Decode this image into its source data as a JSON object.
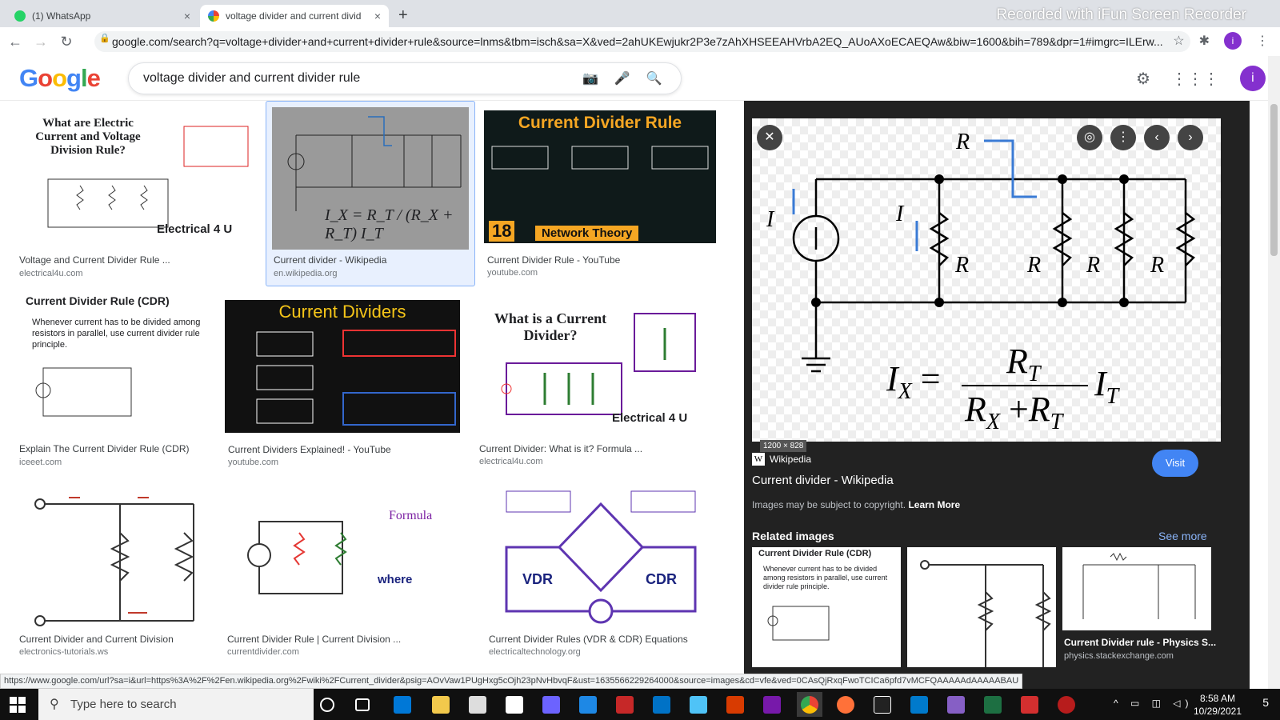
{
  "browser": {
    "tabs": [
      {
        "label": "(1) WhatsApp",
        "close": "×"
      },
      {
        "label": "voltage divider and current divid",
        "close": "×"
      }
    ],
    "new_tab": "+",
    "recorder_watermark": "Recorded with iFun Screen Recorder",
    "url": "google.com/search?q=voltage+divider+and+current+divider+rule&source=lnms&tbm=isch&sa=X&ved=2ahUKEwjukr2P3e7zAhXHSEEAHVrbA2EQ_AUoAXoECAEQAw&biw=1600&bih=789&dpr=1#imgrc=ILErw...",
    "profile_initial": "i"
  },
  "google": {
    "logo": "Google",
    "query": "voltage divider and current divider rule",
    "profile_initial": "i"
  },
  "results": [
    {
      "title": "Voltage and Current Divider Rule ...",
      "source": "electrical4u.com",
      "thumb_heading": "What are Electric Current and Voltage Division Rule?",
      "thumb_brand": "Electrical 4 U"
    },
    {
      "title": "Current divider - Wikipedia",
      "source": "en.wikipedia.org",
      "thumb_formula": "I_X = R_T / (R_X + R_T) I_T"
    },
    {
      "title": "Current Divider Rule - YouTube",
      "source": "youtube.com",
      "thumb_heading": "Current Divider Rule",
      "thumb_badge": "18",
      "thumb_footer": "Network Theory"
    },
    {
      "title": "Explain The Current Divider Rule (CDR)",
      "source": "iceeet.com",
      "thumb_heading": "Current Divider Rule (CDR)",
      "thumb_body": "Whenever current has to be divided among resistors in parallel, use current divider rule principle."
    },
    {
      "title": "Current Dividers Explained! - YouTube",
      "source": "youtube.com",
      "thumb_heading": "Current Dividers"
    },
    {
      "title": "Current Divider: What is it? Formula ...",
      "source": "electrical4u.com",
      "thumb_heading": "What is a Current Divider?",
      "thumb_brand": "Electrical 4 U"
    },
    {
      "title": "Current Divider and Current Division",
      "source": "electronics-tutorials.ws"
    },
    {
      "title": "Current Divider Rule | Current Division ...",
      "source": "currentdivider.com",
      "thumb_formula_label": "Formula",
      "thumb_where": "where"
    },
    {
      "title": "Current Divider Rules (VDR & CDR) Equations",
      "source": "electricaltechnology.org",
      "thumb_left": "VDR",
      "thumb_right": "CDR"
    }
  ],
  "panel": {
    "image_size": "1200 × 828",
    "source_name": "Wikipedia",
    "title": "Current divider - Wikipedia",
    "visit": "Visit",
    "copyright": "Images may be subject to copyright.",
    "learn_more": "Learn More",
    "related_heading": "Related images",
    "see_more": "See more",
    "related": [
      {
        "heading": "Current Divider Rule (CDR)",
        "body": "Whenever current has to be divided among resistors in parallel, use current divider rule principle."
      },
      {
        "heading": ""
      },
      {
        "caption": "Current Divider rule - Physics S...",
        "source": "physics.stackexchange.com"
      }
    ],
    "diagram_labels": {
      "rt": "R",
      "it": "I",
      "ix": "I",
      "rx": "R",
      "r1": "R",
      "r2": "R",
      "r3": "R"
    }
  },
  "status_url": "https://www.google.com/url?sa=i&url=https%3A%2F%2Fen.wikipedia.org%2Fwiki%2FCurrent_divider&psig=AOvVaw1PUgHxg5cOjh23pNvHbvqF&ust=1635566229264000&source=images&cd=vfe&ved=0CAsQjRxqFwoTCICa6pfd7vMCFQAAAAAdAAAAABAU",
  "taskbar": {
    "search_placeholder": "Type here to search",
    "time": "8:58 AM",
    "date": "10/29/2021",
    "notifications": "5"
  }
}
